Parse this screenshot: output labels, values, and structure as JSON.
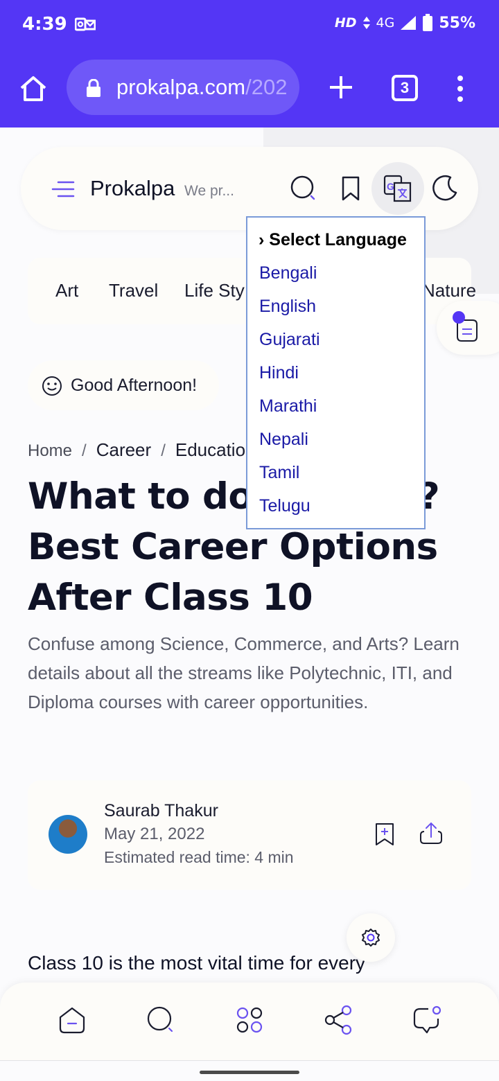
{
  "status_bar": {
    "time": "4:39",
    "network_hd": "HD",
    "network_type": "4G",
    "battery": "55%"
  },
  "browser": {
    "url_main": "prokalpa.com",
    "url_dim": "/202",
    "tab_count": "3"
  },
  "header": {
    "brand": "Prokalpa",
    "tagline": "We pr..."
  },
  "categories": [
    "Art",
    "Travel",
    "Life Sty",
    "Nature"
  ],
  "greeting": "Good Afternoon!",
  "breadcrumb": {
    "home": "Home",
    "separator": "/",
    "career": "Career",
    "education": "Educatio"
  },
  "article": {
    "title_line1": "What to do",
    "title_line1_end": "?",
    "title_line2": "Best Career Options",
    "title_line3": "After Class 10",
    "description": "Confuse among Science, Commerce, and Arts? Learn details about all the streams like Polytechnic, ITI, and Diploma courses with career opportunities.",
    "author_name": "Saurab Thakur",
    "date": "May 21, 2022",
    "read_time": "Estimated read time: 4 min",
    "body_start": "Class 10 is the most vital time for every"
  },
  "language_dropdown": {
    "heading": "› Select Language",
    "options": [
      "Bengali",
      "English",
      "Gujarati",
      "Hindi",
      "Marathi",
      "Nepali",
      "Tamil",
      "Telugu"
    ]
  },
  "colors": {
    "brand": "#5436f5",
    "accent": "#6a52f0",
    "link": "#1a1aa6"
  },
  "icons": [
    "home-icon",
    "lock-icon",
    "plus-icon",
    "more-icon",
    "menu-icon",
    "search-icon",
    "bookmark-icon",
    "translate-icon",
    "moon-icon",
    "smile-icon",
    "share-icon",
    "gear-icon",
    "apps-icon",
    "network-icon",
    "chat-icon"
  ]
}
